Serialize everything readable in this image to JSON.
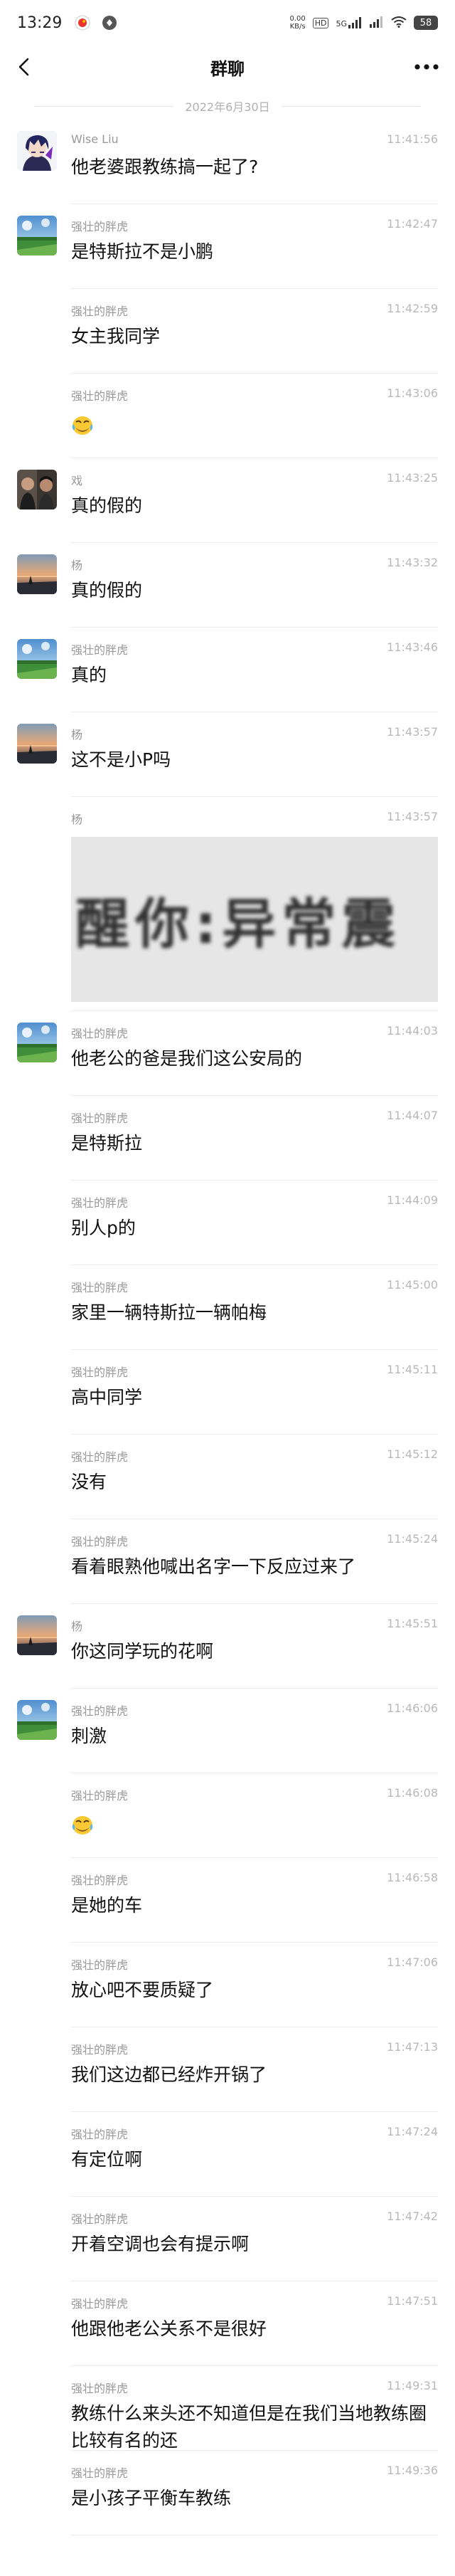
{
  "status_bar": {
    "time": "13:29",
    "net_speed_value": "0.00",
    "net_speed_unit": "KB/s",
    "hd_label": "HD",
    "signal_label": "5G",
    "battery": "58"
  },
  "header": {
    "title": "群聊"
  },
  "date_divider": "2022年6月30日",
  "messages": [
    {
      "avatar": "anime",
      "sender": "Wise Liu",
      "time": "11:41:56",
      "type": "text",
      "text": "他老婆跟教练搞一起了?"
    },
    {
      "avatar": "field",
      "sender": "强壮的胖虎",
      "time": "11:42:47",
      "type": "text",
      "text": "是特斯拉不是小鹏"
    },
    {
      "avatar": "",
      "sender": "强壮的胖虎",
      "time": "11:42:59",
      "type": "text",
      "text": "女主我同学"
    },
    {
      "avatar": "",
      "sender": "强壮的胖虎",
      "time": "11:43:06",
      "type": "emoji",
      "text": ""
    },
    {
      "avatar": "people",
      "sender": "戏",
      "time": "11:43:25",
      "type": "text",
      "text": "真的假的"
    },
    {
      "avatar": "sunset",
      "sender": "杨",
      "time": "11:43:32",
      "type": "text",
      "text": "真的假的"
    },
    {
      "avatar": "field",
      "sender": "强壮的胖虎",
      "time": "11:43:46",
      "type": "text",
      "text": "真的"
    },
    {
      "avatar": "sunset",
      "sender": "杨",
      "time": "11:43:57",
      "type": "text",
      "text": "这不是小P吗"
    },
    {
      "avatar": "",
      "sender": "杨",
      "time": "11:43:57",
      "type": "image",
      "text": "醒你:异常震"
    },
    {
      "avatar": "field",
      "sender": "强壮的胖虎",
      "time": "11:44:03",
      "type": "text",
      "text": "他老公的爸是我们这公安局的"
    },
    {
      "avatar": "",
      "sender": "强壮的胖虎",
      "time": "11:44:07",
      "type": "text",
      "text": "是特斯拉"
    },
    {
      "avatar": "",
      "sender": "强壮的胖虎",
      "time": "11:44:09",
      "type": "text",
      "text": "别人p的"
    },
    {
      "avatar": "",
      "sender": "强壮的胖虎",
      "time": "11:45:00",
      "type": "text",
      "text": "家里一辆特斯拉一辆帕梅"
    },
    {
      "avatar": "",
      "sender": "强壮的胖虎",
      "time": "11:45:11",
      "type": "text",
      "text": "高中同学"
    },
    {
      "avatar": "",
      "sender": "强壮的胖虎",
      "time": "11:45:12",
      "type": "text",
      "text": "没有"
    },
    {
      "avatar": "",
      "sender": "强壮的胖虎",
      "time": "11:45:24",
      "type": "text",
      "text": "看着眼熟他喊出名字一下反应过来了"
    },
    {
      "avatar": "sunset",
      "sender": "杨",
      "time": "11:45:51",
      "type": "text",
      "text": "你这同学玩的花啊"
    },
    {
      "avatar": "field",
      "sender": "强壮的胖虎",
      "time": "11:46:06",
      "type": "text",
      "text": "刺激"
    },
    {
      "avatar": "",
      "sender": "强壮的胖虎",
      "time": "11:46:08",
      "type": "emoji",
      "text": ""
    },
    {
      "avatar": "",
      "sender": "强壮的胖虎",
      "time": "11:46:58",
      "type": "text",
      "text": "是她的车"
    },
    {
      "avatar": "",
      "sender": "强壮的胖虎",
      "time": "11:47:06",
      "type": "text",
      "text": "放心吧不要质疑了"
    },
    {
      "avatar": "",
      "sender": "强壮的胖虎",
      "time": "11:47:13",
      "type": "text",
      "text": "我们这边都已经炸开锅了"
    },
    {
      "avatar": "",
      "sender": "强壮的胖虎",
      "time": "11:47:24",
      "type": "text",
      "text": "有定位啊"
    },
    {
      "avatar": "",
      "sender": "强壮的胖虎",
      "time": "11:47:42",
      "type": "text",
      "text": "开着空调也会有提示啊"
    },
    {
      "avatar": "",
      "sender": "强壮的胖虎",
      "time": "11:47:51",
      "type": "text",
      "text": "他跟他老公关系不是很好"
    },
    {
      "avatar": "",
      "sender": "强壮的胖虎",
      "time": "11:49:31",
      "type": "text",
      "text": "教练什么来头还不知道但是在我们当地教练圈比较有名的还"
    },
    {
      "avatar": "",
      "sender": "强壮的胖虎",
      "time": "11:49:36",
      "type": "text",
      "text": "是小孩子平衡车教练"
    }
  ]
}
